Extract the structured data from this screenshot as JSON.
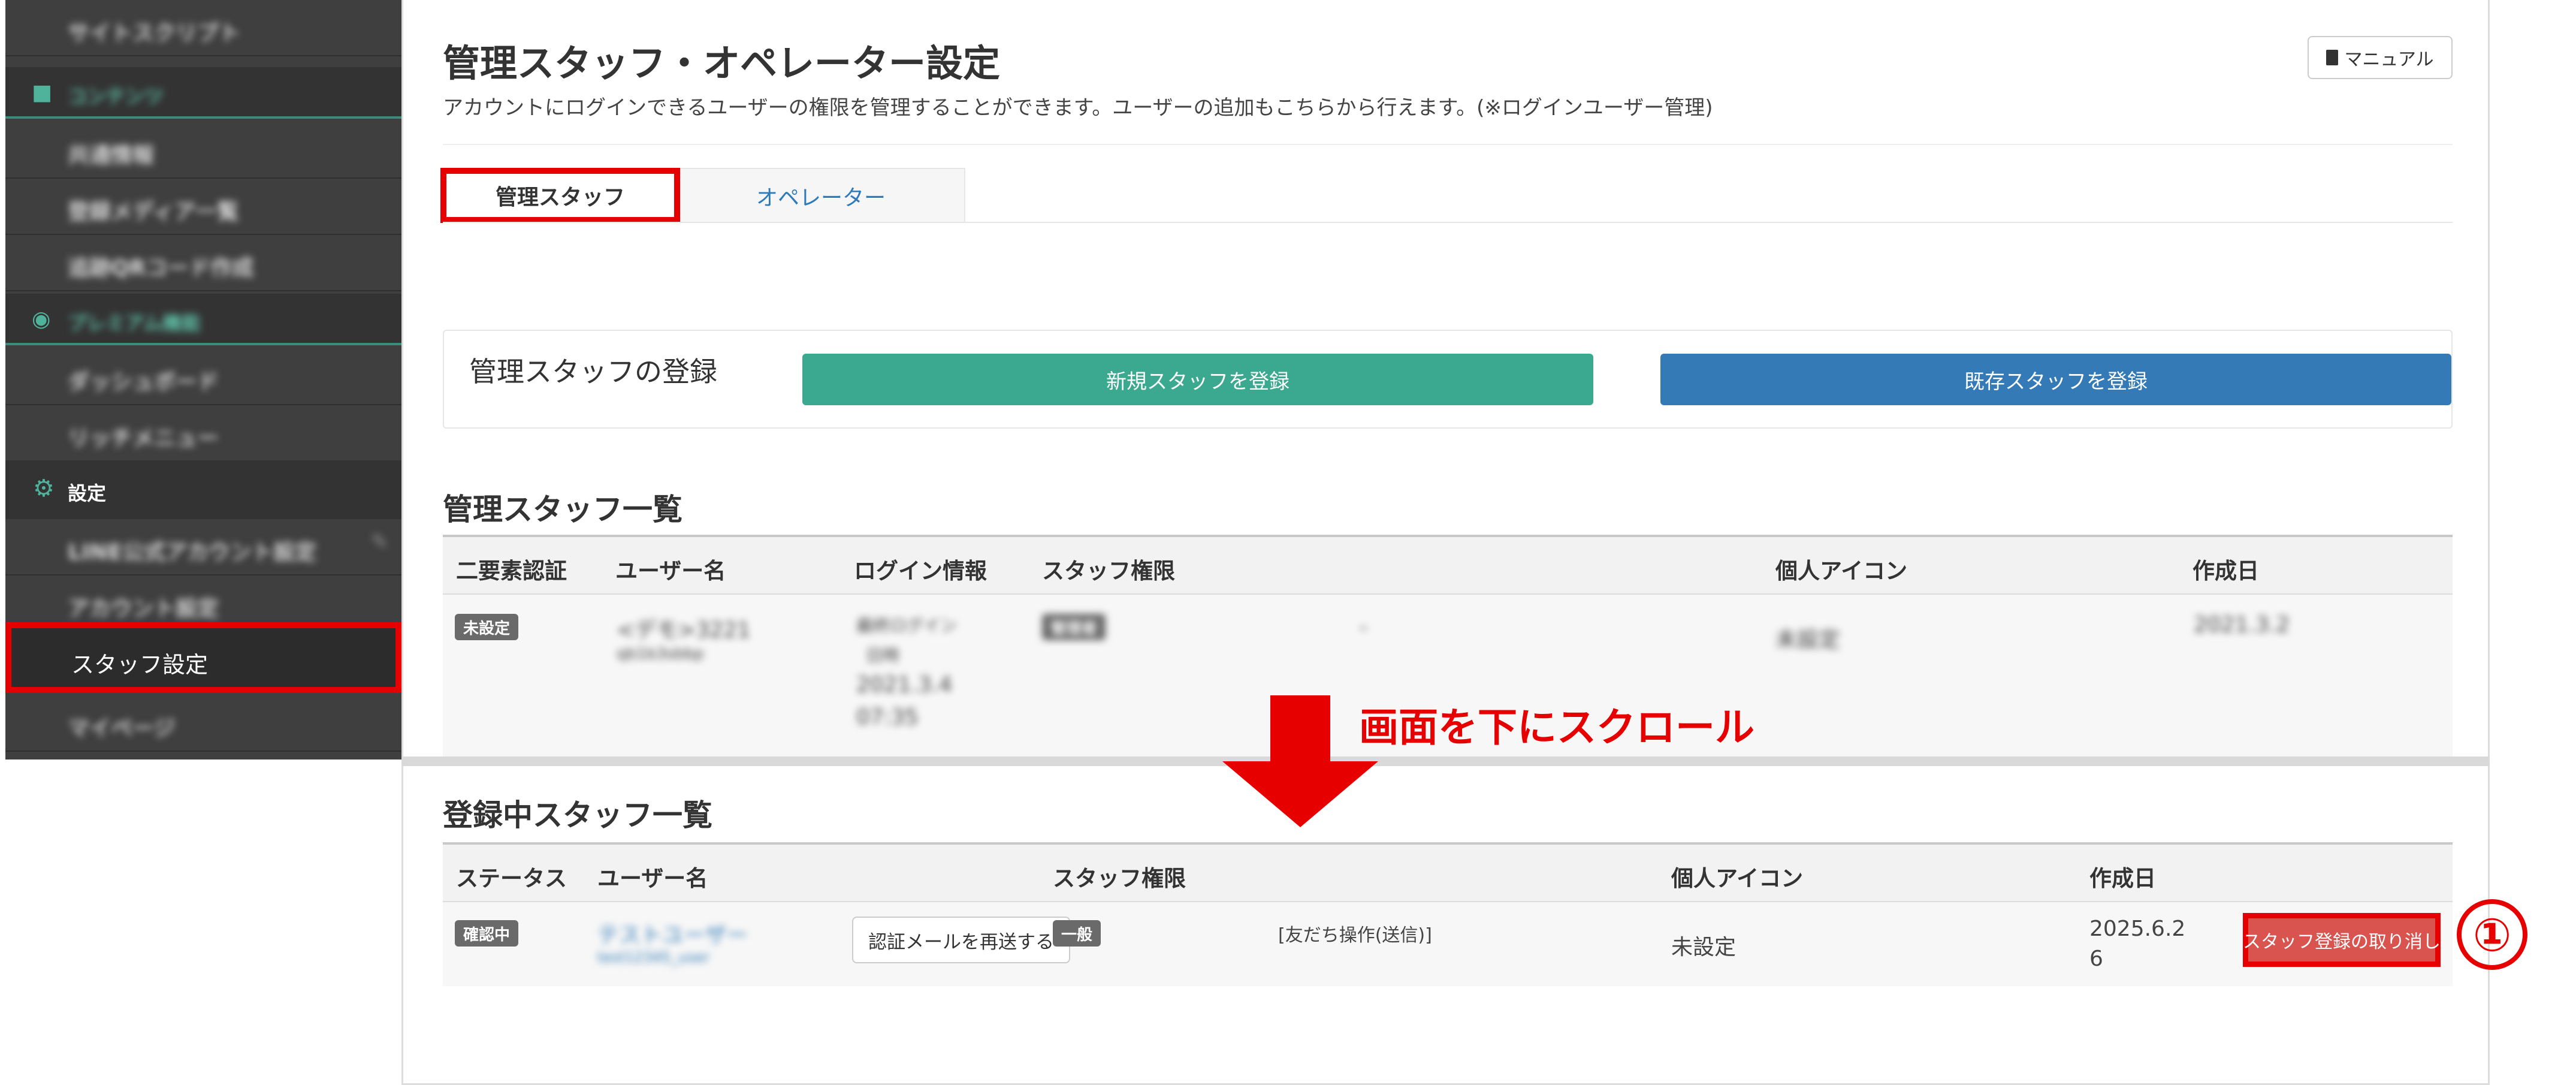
{
  "sidebar": {
    "items": [
      {
        "label": "サイトスクリプト"
      },
      {
        "label": "コンテンツ",
        "type": "section"
      },
      {
        "label": "共通情報"
      },
      {
        "label": "登録メディア一覧"
      },
      {
        "label": "追跡QRコード作成"
      },
      {
        "label": "プレミアム機能",
        "type": "section"
      },
      {
        "label": "ダッシュボード"
      },
      {
        "label": "リッチメニュー"
      },
      {
        "label": "設定",
        "type": "section"
      },
      {
        "label": "LINE公式アカウント設定"
      },
      {
        "label": "アカウント設定"
      },
      {
        "label": "スタッフ設定",
        "active": true
      },
      {
        "label": "マイページ"
      }
    ]
  },
  "header": {
    "title": "管理スタッフ・オペレーター設定",
    "description": "アカウントにログインできるユーザーの権限を管理することができます。ユーザーの追加もこちらから行えます。(※ログインユーザー管理)",
    "manual_label": "マニュアル"
  },
  "tabs": [
    {
      "label": "管理スタッフ",
      "active": true
    },
    {
      "label": "オペレーター",
      "active": false
    }
  ],
  "registration": {
    "label": "管理スタッフの登録",
    "new_button": "新規スタッフを登録",
    "existing_button": "既存スタッフを登録"
  },
  "staff_list": {
    "title": "管理スタッフ一覧",
    "columns": [
      "二要素認証",
      "ユーザー名",
      "ログイン情報",
      "スタッフ権限",
      "個人アイコン",
      "作成日"
    ],
    "rows": [
      {
        "two_factor": "未設定",
        "username": "<デモ>3221",
        "user_id": "qb1b3sbbp",
        "login_info": [
          "最終ログイン",
          "日時",
          "2021.3.4",
          "07:35"
        ],
        "role": "管理者",
        "role_detail": "-",
        "icon": "未設定",
        "created": "2021.3.2"
      }
    ]
  },
  "annotation": {
    "scroll_text": "画面を下にスクロール",
    "step_number": "①"
  },
  "registering_list": {
    "title": "登録中スタッフ一覧",
    "columns": [
      "ステータス",
      "ユーザー名",
      "スタッフ権限",
      "個人アイコン",
      "作成日"
    ],
    "rows": [
      {
        "status": "確認中",
        "username": "テストユーザー",
        "user_id": "test12345_user",
        "resend_button": "認証メールを再送する",
        "role": "一般",
        "permissions": "[友だち操作(送信)]",
        "icon": "未設定",
        "created_line1": "2025.6.2",
        "created_line2": "6",
        "cancel_button": "スタッフ登録の取り消し"
      }
    ]
  },
  "colors": {
    "sidebar_bg": "#3f3f3f",
    "accent_green": "#3aa98f",
    "accent_blue": "#337ab7",
    "danger": "#d9534f",
    "annotation_red": "#e60000",
    "link_blue": "#2f7ab8"
  },
  "icons": {
    "folder": "folder-icon",
    "premium": "premium-icon",
    "gear": "gear-icon",
    "edit": "edit-icon",
    "book": "book-icon"
  }
}
